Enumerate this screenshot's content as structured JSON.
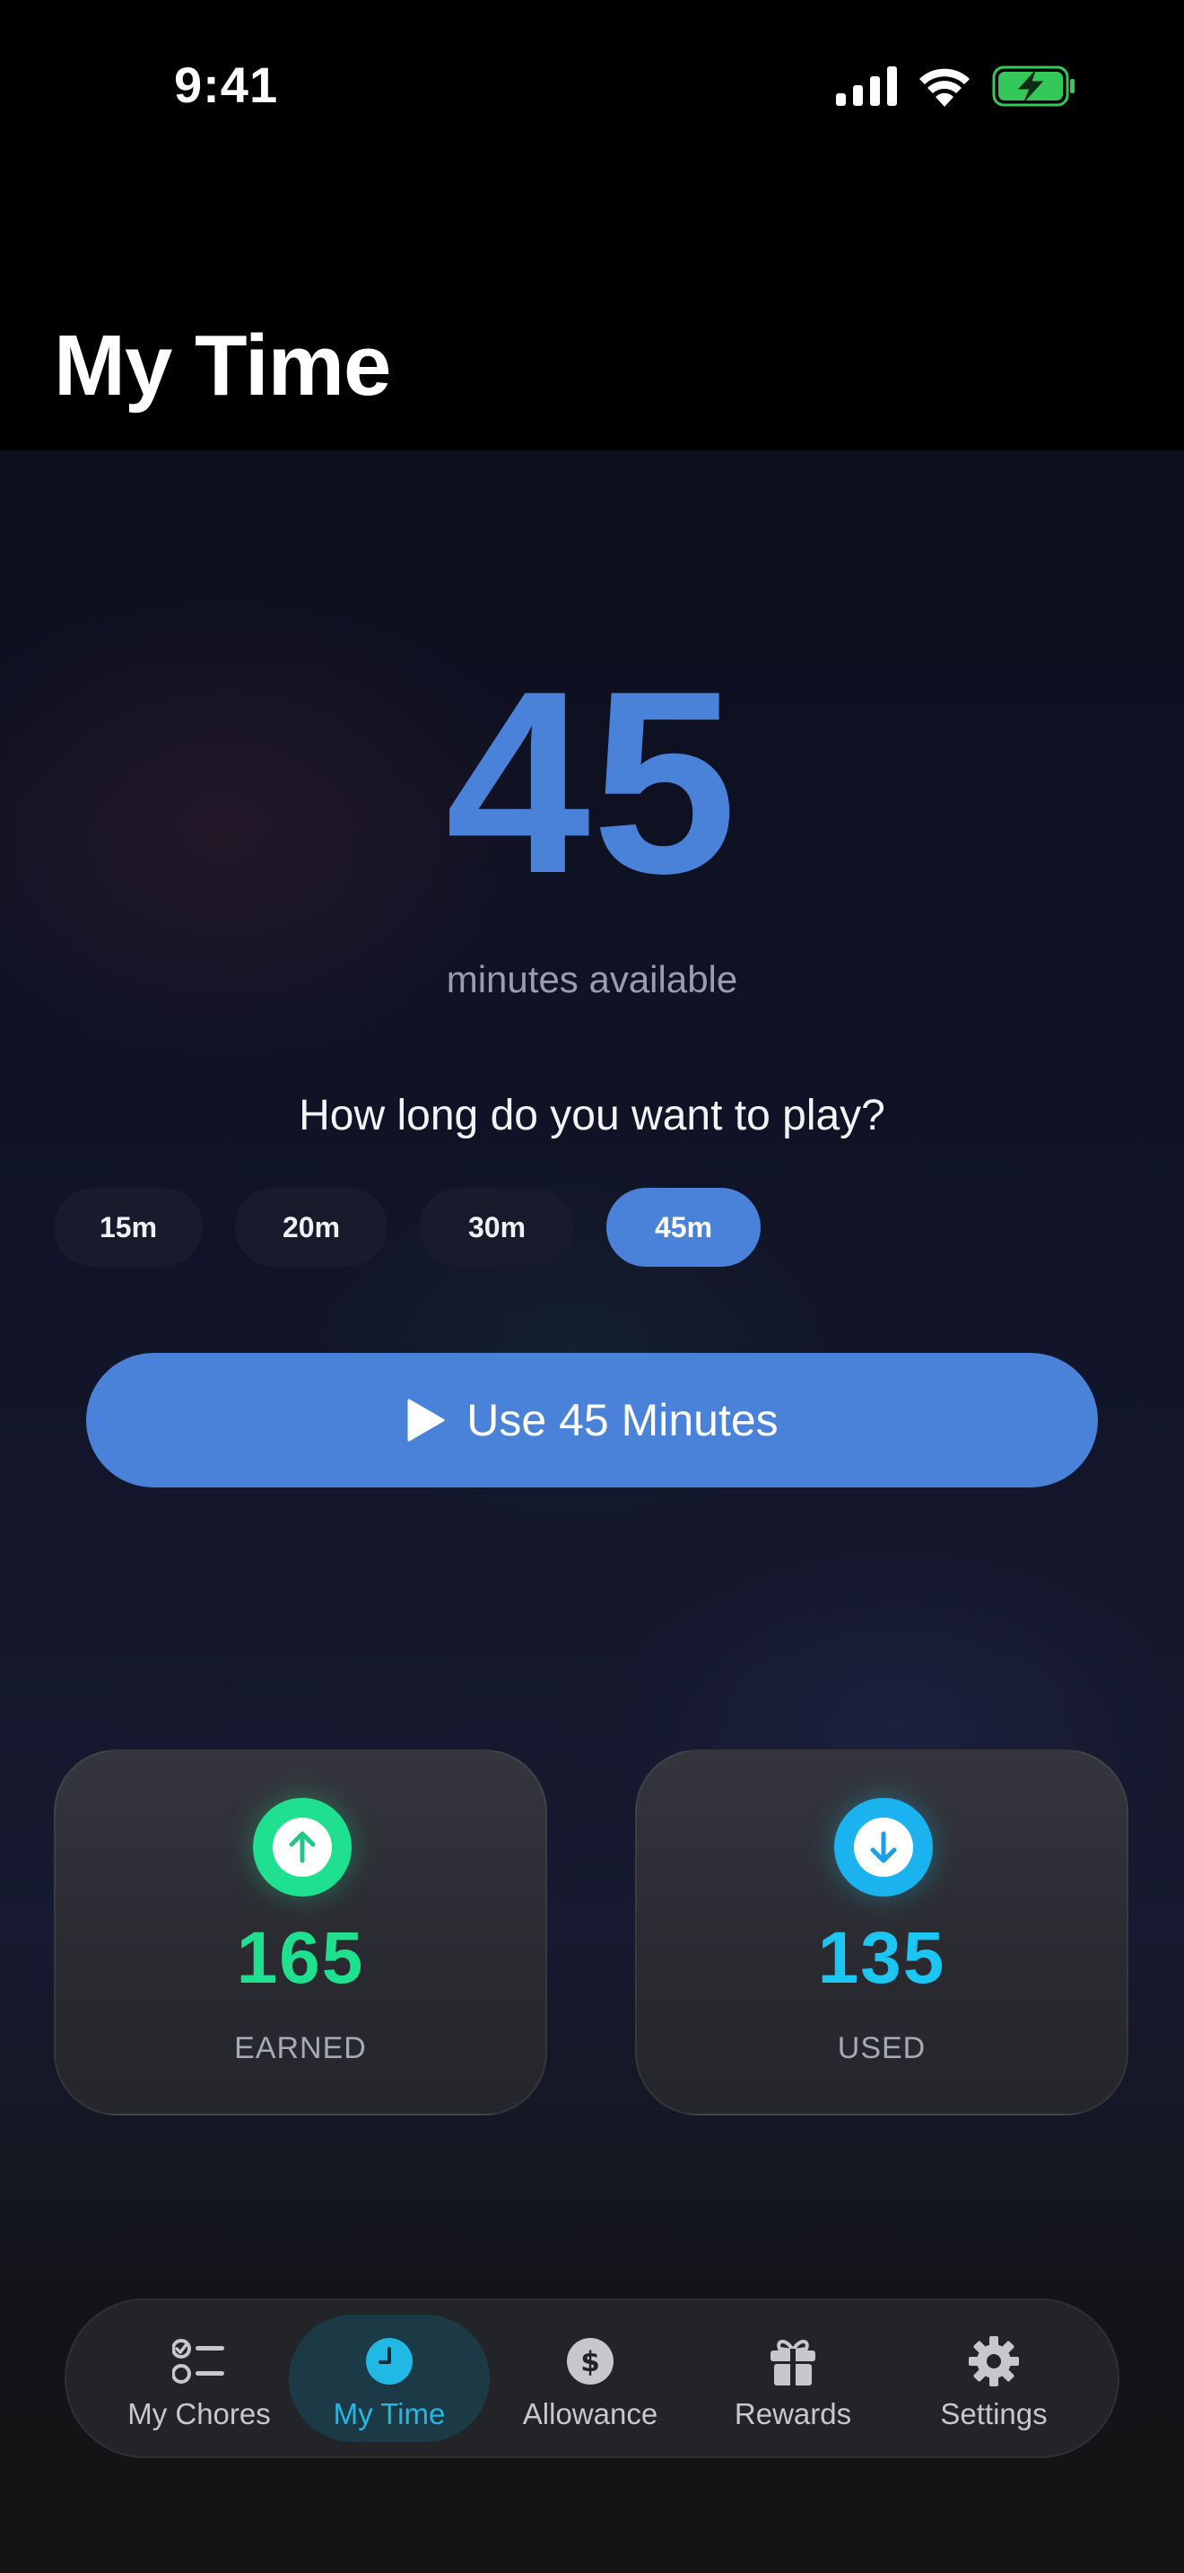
{
  "status_bar": {
    "time": "9:41",
    "icons": [
      "cellular-signal-icon",
      "wifi-icon",
      "battery-charging-icon"
    ]
  },
  "header": {
    "title": "My Time"
  },
  "balance": {
    "minutes": "45",
    "label": "minutes available"
  },
  "picker": {
    "question": "How long do you want to play?",
    "options": [
      "15m",
      "20m",
      "30m",
      "45m"
    ],
    "selected": "45m"
  },
  "use_button": {
    "label": "Use 45 Minutes",
    "icon": "play-icon"
  },
  "stats": {
    "earned": {
      "value": "165",
      "label": "EARNED",
      "icon": "arrow-up-icon",
      "color": "#1fe08f"
    },
    "used": {
      "value": "135",
      "label": "USED",
      "icon": "arrow-down-icon",
      "color": "#1cc6f2"
    }
  },
  "tab_bar": {
    "items": [
      {
        "label": "My Chores",
        "icon": "checklist-icon"
      },
      {
        "label": "My Time",
        "icon": "clock-icon",
        "active": true
      },
      {
        "label": "Allowance",
        "icon": "dollar-icon"
      },
      {
        "label": "Rewards",
        "icon": "gift-icon"
      },
      {
        "label": "Settings",
        "icon": "gear-icon"
      }
    ]
  },
  "colors": {
    "accent": "#4b82d9",
    "earned": "#1fe08f",
    "used": "#1cc6f2",
    "tab_active": "#22b8e6",
    "battery": "#34c759"
  }
}
